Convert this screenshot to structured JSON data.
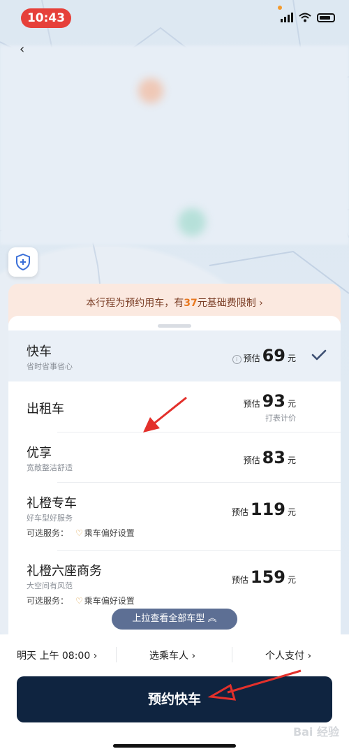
{
  "status": {
    "time": "10:43"
  },
  "notice": {
    "prefix": "本行程为预约用车，有",
    "amount": "37",
    "suffix": "元基础费限制 ›"
  },
  "rows": [
    {
      "name": "快车",
      "sub": "省时省事省心",
      "est": "预估",
      "price": "69",
      "unit": "元",
      "selected": true
    },
    {
      "name": "出租车",
      "sub": "",
      "est": "预估",
      "price": "93",
      "unit": "元",
      "extra": "打表计价"
    },
    {
      "name": "优享",
      "sub": "宽敞整洁舒适",
      "est": "预估",
      "price": "83",
      "unit": "元"
    },
    {
      "name": "礼橙专车",
      "sub": "好车型好服务",
      "est": "预估",
      "price": "119",
      "unit": "元",
      "svc_label": "可选服务：",
      "svc_item": "乘车偏好设置"
    },
    {
      "name": "礼橙六座商务",
      "sub": "大空间有风范",
      "est": "预估",
      "price": "159",
      "unit": "元",
      "svc_label": "可选服务：",
      "svc_item": "乘车偏好设置"
    }
  ],
  "expand": {
    "label": "上拉查看全部车型 ︽"
  },
  "options": {
    "time": "明天 上午 08:00 ›",
    "rider": "选乘车人 ›",
    "pay": "个人支付 ›"
  },
  "cta": {
    "label": "预约快车"
  },
  "watermark": "Bai 经验",
  "colors": {
    "cta": "#0f2440",
    "accent": "#e8781f",
    "pill": "#5d6f94",
    "arrow": "#e3302b"
  }
}
